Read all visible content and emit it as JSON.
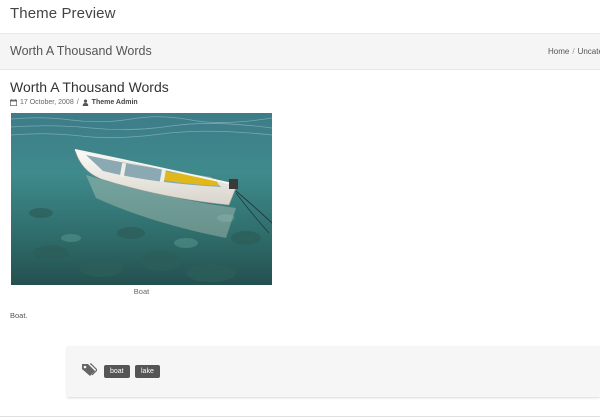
{
  "header": {
    "site_title": "Theme Preview"
  },
  "title_bar": {
    "title": "Worth A Thousand Words",
    "breadcrumb": {
      "home": "Home",
      "separator": "/",
      "current": "Uncate"
    }
  },
  "post": {
    "title": "Worth A Thousand Words",
    "date": "17 October, 2008",
    "meta_separator": "/",
    "author": "Theme Admin",
    "image_icon": "boat-photo",
    "caption": "Boat",
    "body_text": "Boat."
  },
  "tags": {
    "icon": "tags-icon",
    "items": [
      "boat",
      "lake"
    ]
  },
  "colors": {
    "water": "#2f6b6e",
    "boat_hull": "#f2f0ea",
    "boat_interior": "#e0b81a",
    "tag_bg": "#555555"
  }
}
